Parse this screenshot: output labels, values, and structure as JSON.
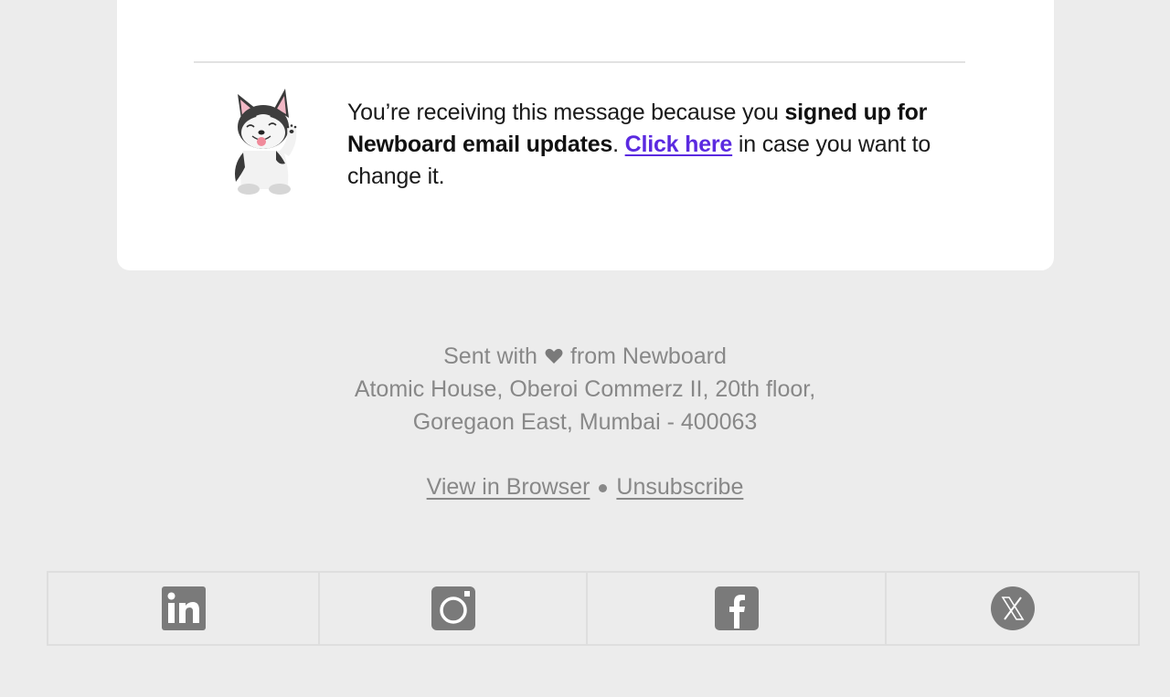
{
  "card": {
    "mascot_icon": "husky-waving-icon",
    "notice": {
      "text_1": "You’re receiving this message because you ",
      "bold": "signed up for Newboard email updates",
      "text_2": ". ",
      "link": "Click here",
      "text_3": " in case you want to change it."
    }
  },
  "footer": {
    "sent_prefix": "Sent with",
    "heart_icon": "heart-icon",
    "sent_suffix": "from Newboard",
    "address_line_1": "Atomic House, Oberoi Commerz II, 20th floor,",
    "address_line_2": "Goregaon East, Mumbai - 400063",
    "view_in_browser": "View in Browser",
    "unsubscribe": "Unsubscribe"
  },
  "social": [
    {
      "name": "LinkedIn",
      "icon": "linkedin-icon"
    },
    {
      "name": "Instagram",
      "icon": "instagram-icon"
    },
    {
      "name": "Facebook",
      "icon": "facebook-icon"
    },
    {
      "name": "X",
      "icon": "x-icon"
    }
  ],
  "colors": {
    "background": "#ececec",
    "card": "#ffffff",
    "link": "#5b2ae0",
    "muted_text": "#888888",
    "icon": "#7a7a7a"
  }
}
